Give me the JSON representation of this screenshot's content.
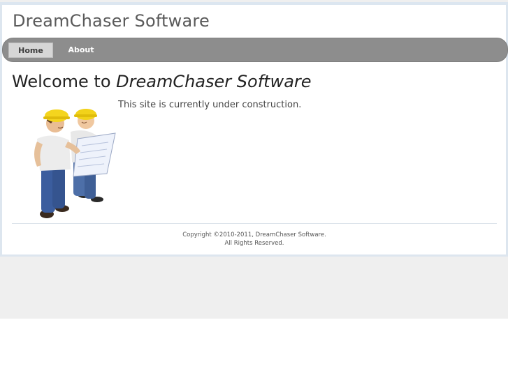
{
  "site": {
    "title": "DreamChaser Software"
  },
  "nav": {
    "items": [
      {
        "label": "Home",
        "active": true
      },
      {
        "label": "About",
        "active": false
      }
    ]
  },
  "main": {
    "heading_prefix": "Welcome to ",
    "heading_emphasis": "DreamChaser Software",
    "message": "This site is currently under construction.",
    "illustration_icon": "construction-workers-icon"
  },
  "footer": {
    "copyright": "Copyright ©2010-2011, DreamChaser Software.",
    "rights": "All Rights Reserved."
  },
  "colors": {
    "navbar": "#8d8d8d",
    "active_tab": "#d6d6d6",
    "page_background": "#efefef",
    "border": "#dde6ef"
  }
}
